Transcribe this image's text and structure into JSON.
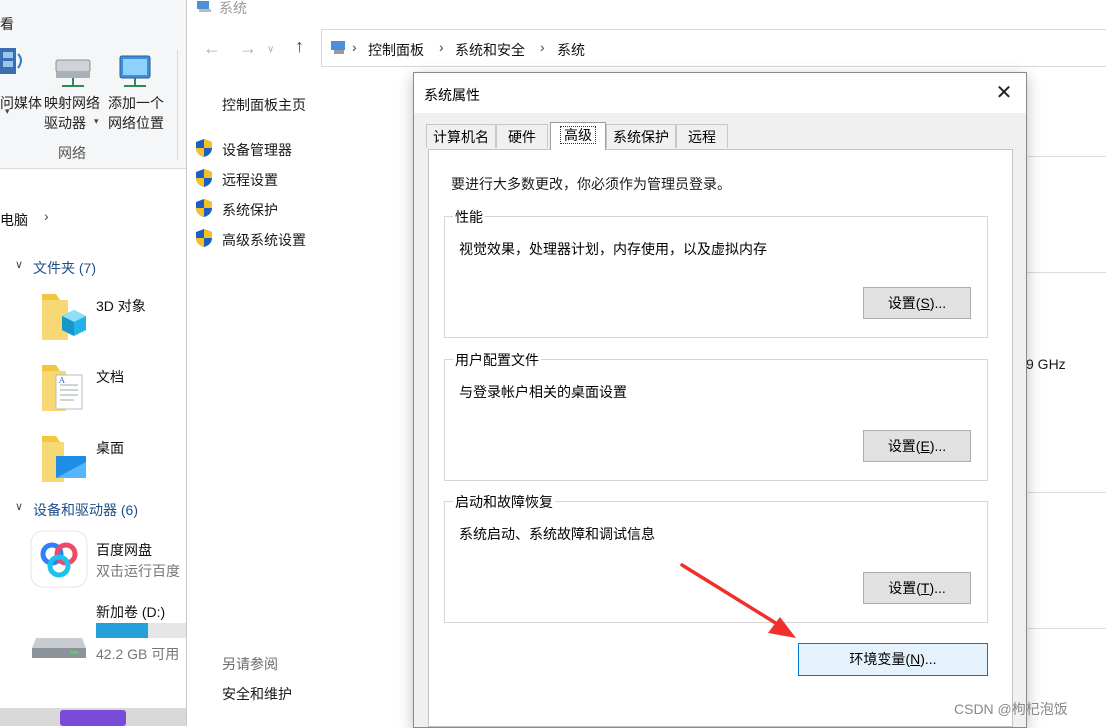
{
  "explorer": {
    "ribbon": {
      "media_label": "问媒体",
      "map_drive_line1": "映射网络",
      "map_drive_line2": "驱动器",
      "add_location_line1": "添加一个",
      "add_location_line2": "网络位置",
      "group_label": "网络",
      "top_partial": "看"
    },
    "breadcrumb": "此电脑",
    "breadcrumb_partial": "电脑",
    "sections": [
      {
        "title": "文件夹 (7)"
      },
      {
        "title": "设备和驱动器 (6)"
      }
    ],
    "folders": [
      {
        "name": "3D 对象",
        "icon": "3d-objects-folder-icon"
      },
      {
        "name": "文档",
        "icon": "documents-folder-icon"
      },
      {
        "name": "桌面",
        "icon": "desktop-folder-icon"
      }
    ],
    "devices": [
      {
        "name": "百度网盘",
        "sub": "双击运行百度"
      },
      {
        "name": "新加卷 (D:)",
        "sub": "42.2 GB 可用",
        "fill_fraction": 0.58
      }
    ]
  },
  "control_panel": {
    "window_title": "系统",
    "breadcrumb": [
      "控制面板",
      "系统和安全",
      "系统"
    ],
    "sidebar": {
      "home": "控制面板主页",
      "links": [
        "设备管理器",
        "远程设置",
        "系统保护",
        "高级系统设置"
      ],
      "see_also_label": "另请参阅",
      "see_also_links": [
        "安全和维护"
      ]
    },
    "background_partial": "9 GHz"
  },
  "dialog": {
    "title": "系统属性",
    "tabs": [
      "计算机名",
      "硬件",
      "高级",
      "系统保护",
      "远程"
    ],
    "active_tab": "高级",
    "intro": "要进行大多数更改，你必须作为管理员登录。",
    "groups": [
      {
        "title": "性能",
        "desc": "视觉效果，处理器计划，内存使用，以及虚拟内存",
        "button_pre": "设置(",
        "button_key": "S",
        "button_post": ")..."
      },
      {
        "title": "用户配置文件",
        "desc": "与登录帐户相关的桌面设置",
        "button_pre": "设置(",
        "button_key": "E",
        "button_post": ")..."
      },
      {
        "title": "启动和故障恢复",
        "desc": "系统启动、系统故障和调试信息",
        "button_pre": "设置(",
        "button_key": "T",
        "button_post": ")..."
      }
    ],
    "env_button": {
      "pre": "环境变量(",
      "key": "N",
      "post": ")..."
    }
  },
  "watermark": "CSDN @枸杞泡饭",
  "colors": {
    "annotation_arrow": "#f0312b",
    "accent": "#0078d7"
  }
}
